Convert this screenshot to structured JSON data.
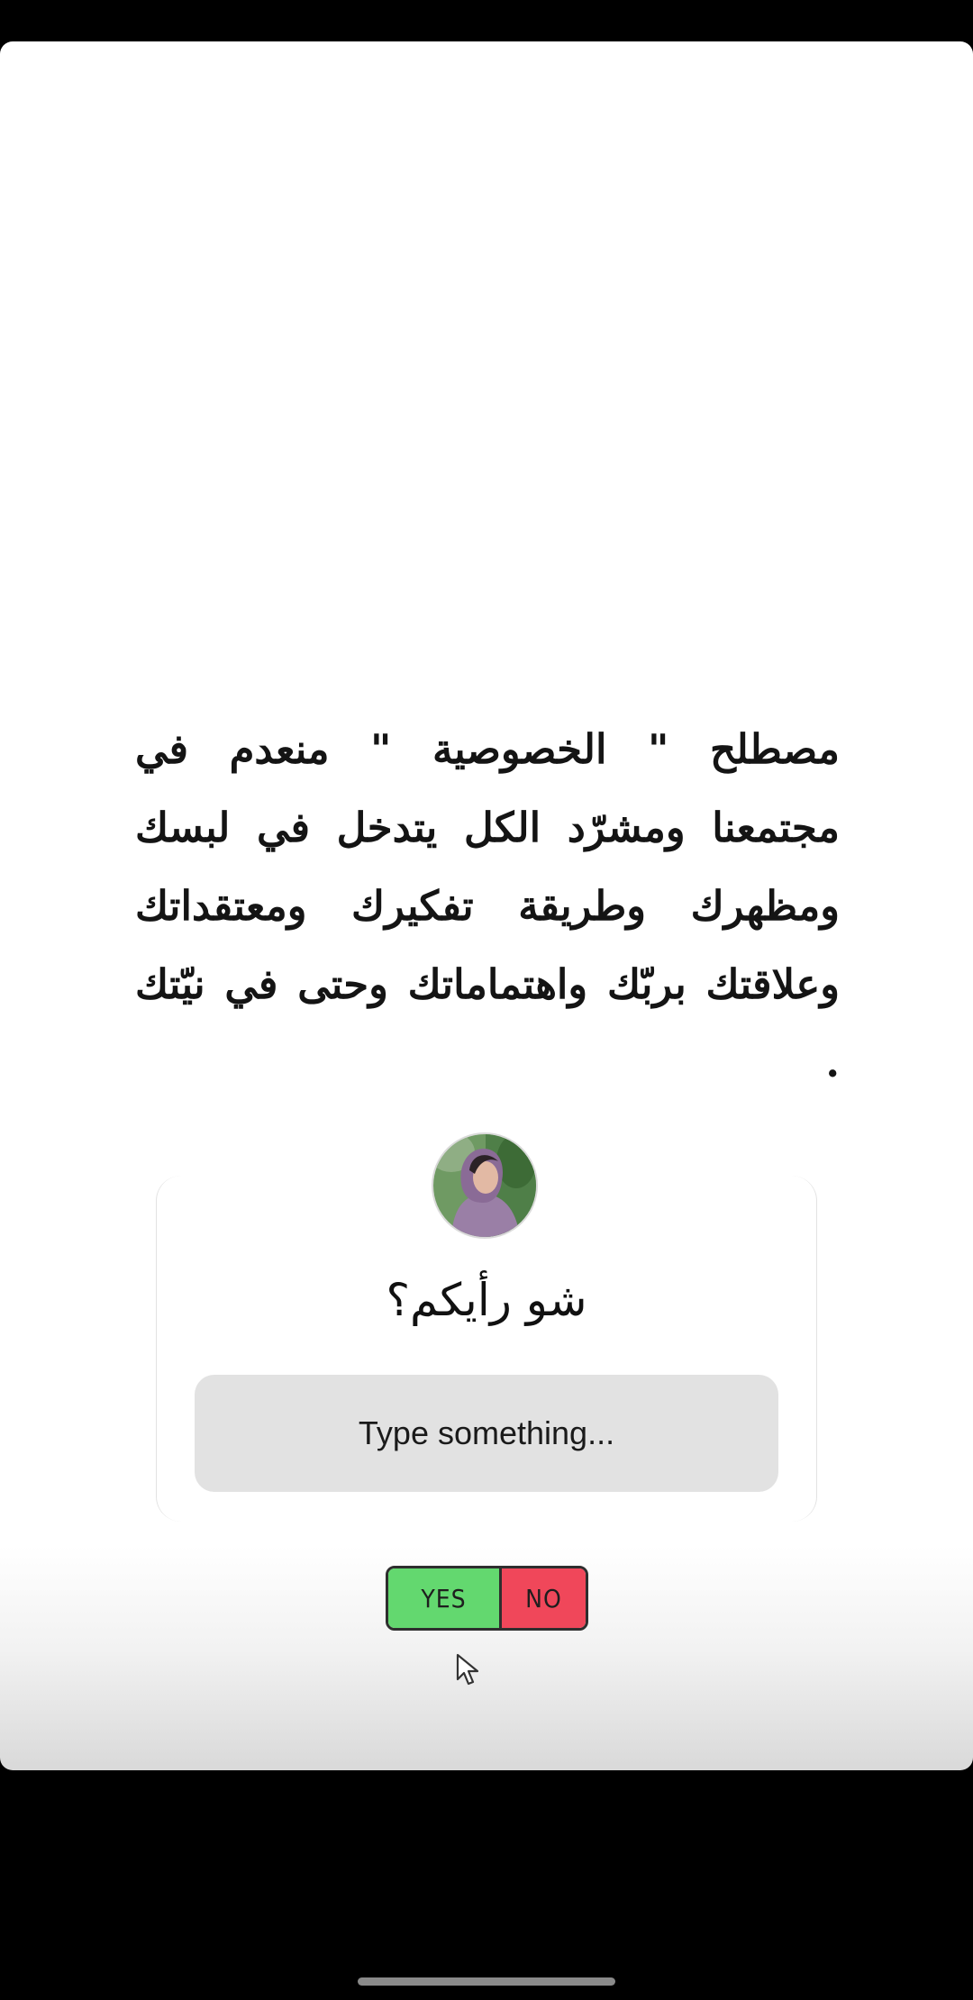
{
  "story": {
    "quote_text": "مصطلح \" الخصوصية \" منعدم في مجتمعنا ومشرّد الكل يتدخل في لبسك ومظهرك وطريقة تفكيرك ومعتقداتك وعلاقتك بربّك واهتماماتك وحتى في نيّتك .",
    "question": {
      "text": "شو رأيكم؟",
      "input_placeholder": "Type something..."
    },
    "toggle": {
      "yes_label": "YES",
      "no_label": "NO",
      "yes_color": "#63d86f",
      "no_color": "#f0475a"
    }
  },
  "icons": {
    "cursor": "mouse-pointer-icon"
  }
}
